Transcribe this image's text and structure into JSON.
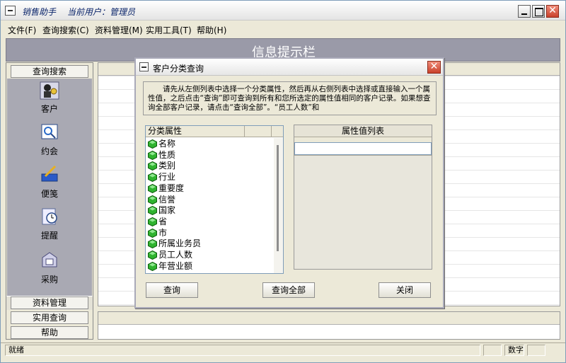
{
  "app": {
    "title_name": "销售助手",
    "title_user": "当前用户：管理员"
  },
  "menu": [
    "文件(F)",
    "查询搜索(C)",
    "资料管理(M)",
    "实用工具(T)",
    "帮助(H)"
  ],
  "info_banner": "信息提示栏",
  "left_panel": {
    "active_category": "查询搜索",
    "items": [
      {
        "label": "客户",
        "icon": "customer-icon"
      },
      {
        "label": "约会",
        "icon": "appointment-icon"
      },
      {
        "label": "便笺",
        "icon": "memo-icon"
      },
      {
        "label": "提醒",
        "icon": "reminder-clock-icon"
      },
      {
        "label": "采购",
        "icon": "purchase-icon"
      }
    ],
    "categories": [
      "资料管理",
      "实用查询",
      "帮助"
    ]
  },
  "statusbar": {
    "status": "就绪",
    "num_indicator": "数字"
  },
  "dialog": {
    "title": "客户分类查询",
    "instruction": "请先从左侧列表中选择一个分类属性，然后再从右侧列表中选择或直接输入一个属性值，之后点击“查询”即可查询到所有和您所选定的属性值相同的客户记录。如果想查询全部客户记录，请点击“查询全部”。“员工人数”和",
    "left_list_header": "分类属性",
    "attributes": [
      "名称",
      "性质",
      "类别",
      "行业",
      "重要度",
      "信誉",
      "国家",
      "省",
      "市",
      "所属业务员",
      "员工人数",
      "年营业额"
    ],
    "right_list_header": "属性值列表",
    "right_input_value": "",
    "buttons": {
      "query": "查询",
      "query_all": "查询全部",
      "close": "关闭"
    }
  }
}
